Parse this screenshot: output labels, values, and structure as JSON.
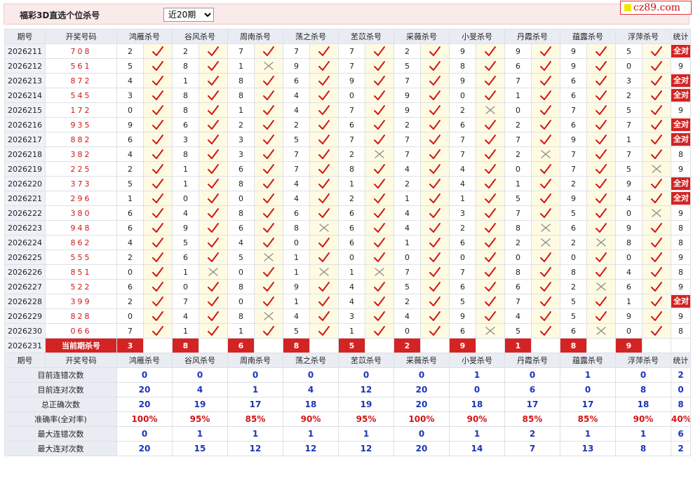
{
  "app": {
    "title": "福彩3D直选个位杀号",
    "period_selected": "近20期",
    "period_options": [
      "近20期"
    ],
    "logo_text": "cz89.com"
  },
  "colors": {
    "accent_red": "#d42323",
    "stat_blue": "#1a35b8",
    "mark_bg": "#fffbe2",
    "header_bg": "#e9ecf2"
  },
  "icons": {
    "hit": "check-icon",
    "miss": "cross-icon"
  },
  "table": {
    "col_issue": "期号",
    "col_draw": "开奖号码",
    "col_stat": "统计",
    "experts": [
      "鸿雁杀号",
      "谷风杀号",
      "周南杀号",
      "荡之杀号",
      "苤苡杀号",
      "采薇杀号",
      "小旻杀号",
      "丹霞杀号",
      "蕴露杀号",
      "浮萍杀号"
    ],
    "all_right_label": "全对",
    "rows": [
      {
        "issue": "2026211",
        "draw": "708",
        "kills": [
          2,
          2,
          7,
          7,
          7,
          2,
          9,
          9,
          9,
          5
        ],
        "stat": "全对"
      },
      {
        "issue": "2026212",
        "draw": "561",
        "kills": [
          5,
          8,
          1,
          9,
          7,
          5,
          8,
          6,
          9,
          0
        ],
        "stat": "9"
      },
      {
        "issue": "2026213",
        "draw": "872",
        "kills": [
          4,
          1,
          8,
          6,
          9,
          7,
          9,
          7,
          6,
          3
        ],
        "stat": "全对"
      },
      {
        "issue": "2026214",
        "draw": "545",
        "kills": [
          3,
          8,
          8,
          4,
          0,
          9,
          0,
          1,
          6,
          2
        ],
        "stat": "全对"
      },
      {
        "issue": "2026215",
        "draw": "172",
        "kills": [
          0,
          8,
          1,
          4,
          7,
          9,
          2,
          0,
          7,
          5
        ],
        "stat": "9"
      },
      {
        "issue": "2026216",
        "draw": "935",
        "kills": [
          9,
          6,
          2,
          2,
          6,
          2,
          6,
          2,
          6,
          7
        ],
        "stat": "全对"
      },
      {
        "issue": "2026217",
        "draw": "882",
        "kills": [
          6,
          3,
          3,
          5,
          7,
          7,
          7,
          7,
          9,
          1
        ],
        "stat": "全对"
      },
      {
        "issue": "2026218",
        "draw": "382",
        "kills": [
          4,
          8,
          3,
          7,
          2,
          7,
          7,
          2,
          7,
          7
        ],
        "stat": "8"
      },
      {
        "issue": "2026219",
        "draw": "225",
        "kills": [
          2,
          1,
          6,
          7,
          8,
          4,
          4,
          0,
          7,
          5
        ],
        "stat": "9"
      },
      {
        "issue": "2026220",
        "draw": "373",
        "kills": [
          5,
          1,
          8,
          4,
          1,
          2,
          4,
          1,
          2,
          9
        ],
        "stat": "全对"
      },
      {
        "issue": "2026221",
        "draw": "296",
        "kills": [
          1,
          0,
          0,
          4,
          2,
          1,
          1,
          5,
          9,
          4
        ],
        "stat": "全对"
      },
      {
        "issue": "2026222",
        "draw": "380",
        "kills": [
          6,
          4,
          8,
          6,
          6,
          4,
          3,
          7,
          5,
          0
        ],
        "stat": "9"
      },
      {
        "issue": "2026223",
        "draw": "948",
        "kills": [
          6,
          9,
          6,
          8,
          6,
          4,
          2,
          8,
          6,
          9
        ],
        "stat": "8"
      },
      {
        "issue": "2026224",
        "draw": "862",
        "kills": [
          4,
          5,
          4,
          0,
          6,
          1,
          6,
          2,
          2,
          8
        ],
        "stat": "8"
      },
      {
        "issue": "2026225",
        "draw": "555",
        "kills": [
          2,
          6,
          5,
          1,
          0,
          0,
          0,
          0,
          0,
          0
        ],
        "stat": "9"
      },
      {
        "issue": "2026226",
        "draw": "851",
        "kills": [
          0,
          1,
          0,
          1,
          1,
          7,
          7,
          8,
          8,
          4
        ],
        "stat": "8"
      },
      {
        "issue": "2026227",
        "draw": "522",
        "kills": [
          6,
          0,
          8,
          9,
          4,
          5,
          6,
          6,
          2,
          6
        ],
        "stat": "9"
      },
      {
        "issue": "2026228",
        "draw": "399",
        "kills": [
          2,
          7,
          0,
          1,
          4,
          2,
          5,
          7,
          5,
          1
        ],
        "stat": "全对"
      },
      {
        "issue": "2026229",
        "draw": "828",
        "kills": [
          0,
          4,
          8,
          4,
          3,
          4,
          9,
          4,
          5,
          9
        ],
        "stat": "9"
      },
      {
        "issue": "2026230",
        "draw": "066",
        "kills": [
          7,
          1,
          1,
          5,
          1,
          0,
          6,
          5,
          6,
          0
        ],
        "stat": "8"
      }
    ],
    "current": {
      "issue": "2026231",
      "label": "当前期杀号",
      "kills": [
        3,
        8,
        6,
        8,
        5,
        2,
        9,
        1,
        8,
        9
      ]
    },
    "stats": [
      {
        "label": "目前连错次数",
        "values": [
          "0",
          "0",
          "0",
          "0",
          "0",
          "0",
          "1",
          "0",
          "1",
          "0"
        ],
        "total": "2"
      },
      {
        "label": "目前连对次数",
        "values": [
          "20",
          "4",
          "1",
          "4",
          "12",
          "20",
          "0",
          "6",
          "0",
          "8"
        ],
        "total": "0"
      },
      {
        "label": "总正确次数",
        "values": [
          "20",
          "19",
          "17",
          "18",
          "19",
          "20",
          "18",
          "17",
          "17",
          "18"
        ],
        "total": "8"
      },
      {
        "label": "准确率(全对率)",
        "values": [
          "100%",
          "95%",
          "85%",
          "90%",
          "95%",
          "100%",
          "90%",
          "85%",
          "85%",
          "90%"
        ],
        "total": "40%",
        "red": true
      },
      {
        "label": "最大连错次数",
        "values": [
          "0",
          "1",
          "1",
          "1",
          "1",
          "0",
          "1",
          "2",
          "1",
          "1"
        ],
        "total": "6"
      },
      {
        "label": "最大连对次数",
        "values": [
          "20",
          "15",
          "12",
          "12",
          "12",
          "20",
          "14",
          "7",
          "13",
          "8"
        ],
        "total": "2"
      }
    ]
  }
}
